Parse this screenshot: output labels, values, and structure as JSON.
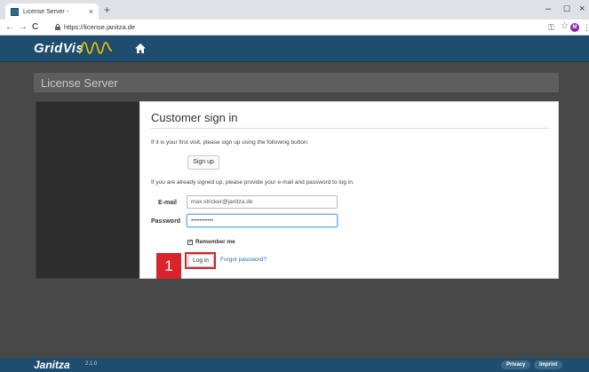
{
  "browser": {
    "tab_title": "License Server -",
    "tab_close": "×",
    "new_tab": "+",
    "minimize": "–",
    "maximize": "☐",
    "close": "×",
    "back": "←",
    "forward": "→",
    "reload": "C",
    "url": "https://license.janitza.de",
    "profile_initial": "M"
  },
  "header": {
    "logo": "GridVis",
    "logo_icon": "wave-icon",
    "home_icon": "home-icon"
  },
  "page": {
    "title": "License Server"
  },
  "signin": {
    "title": "Customer sign in",
    "intro": "If it is your first visit, please sign up using the following button:",
    "signup_label": "Sign up",
    "signed_text": "If you are already signed up, please provide your e-mail and password to log in.",
    "email_label": "E-mail",
    "email_value": "max.stricker@janitza.de",
    "password_label": "Password",
    "password_value": "•••••••••••",
    "remember_label": "Remember me",
    "remember_checked": true,
    "login_label": "Log in",
    "forgot_label": "Forgot password?"
  },
  "annotation": {
    "step": "1",
    "color": "#d9232d"
  },
  "footer": {
    "logo": "Janitza",
    "version": "2.1.0",
    "privacy": "Privacy",
    "imprint": "Imprint"
  },
  "colors": {
    "header_bg": "#1f4d6e",
    "page_bg": "#484848",
    "link": "#2a6fb5"
  }
}
